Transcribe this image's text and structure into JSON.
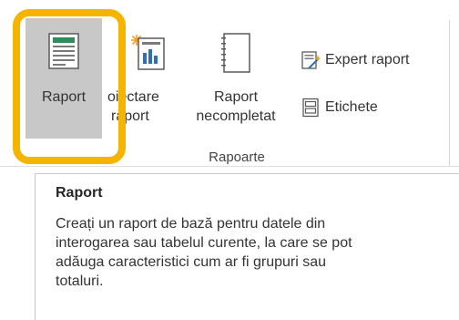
{
  "ribbon": {
    "group_label": "Rapoarte",
    "buttons": {
      "raport": {
        "line1": "Raport"
      },
      "proiectare": {
        "line1": "Proiectare",
        "line2": "raport",
        "visible_line1": "oiectare"
      },
      "necompletat": {
        "line1": "Raport",
        "line2": "necompletat"
      },
      "expert": {
        "label": "Expert raport"
      },
      "etichete": {
        "label": "Etichete"
      }
    },
    "icons": {
      "raport": "report-icon",
      "proiectare": "report-design-icon",
      "necompletat": "blank-report-icon",
      "expert": "report-wizard-icon",
      "etichete": "labels-icon"
    }
  },
  "highlight": {
    "color": "#f5b400"
  },
  "tooltip": {
    "title": "Raport",
    "body_lines": [
      "Creați un raport de bază pentru datele din",
      "interogarea sau tabelul curente, la care se pot",
      "adăuga caracteristici cum ar fi grupuri sau",
      "totaluri."
    ]
  }
}
